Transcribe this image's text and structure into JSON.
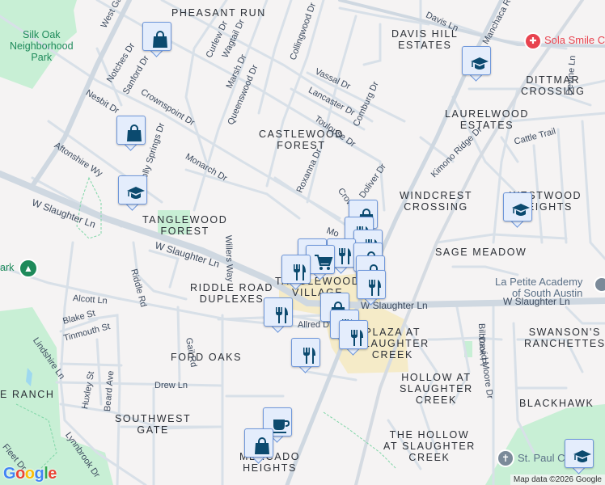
{
  "neighborhoods": {
    "pheasant_run": "PHEASANT RUN",
    "davis_hill": [
      "DAVIS HILL",
      "ESTATES"
    ],
    "dittmar": [
      "DITTMAR",
      "CROSSING"
    ],
    "laurelwood": [
      "LAURELWOOD",
      "ESTATES"
    ],
    "castlewood": [
      "CASTLEWOOD",
      "FOREST"
    ],
    "windcrest": [
      "WINDCREST",
      "CROSSING"
    ],
    "westwood": [
      "WESTWOOD",
      "HEIGHTS"
    ],
    "tanglewood_forest": [
      "TANGLEWOOD",
      "FOREST"
    ],
    "sage_meadow": "SAGE MEADOW",
    "tanglewood_village": [
      "TANGLEWOOD",
      "VILLAGE"
    ],
    "riddle_road": [
      "RIDDLE ROAD",
      "DUPLEXES"
    ],
    "plaza": [
      "PLAZA AT",
      "SLAUGHTER",
      "CREEK"
    ],
    "swansons": [
      "SWANSON'S",
      "RANCHETTES"
    ],
    "ford_oaks": "FORD OAKS",
    "hollow": [
      "HOLLOW AT",
      "SLAUGHTER",
      "CREEK"
    ],
    "blackhawk": "BLACKHAWK",
    "ranch": "E RANCH",
    "southwest_gate": [
      "SOUTHWEST",
      "GATE"
    ],
    "the_hollow": [
      "THE HOLLOW",
      "AT SLAUGHTER",
      "CREEK"
    ],
    "mercado": [
      "MERCADO",
      "HEIGHTS"
    ]
  },
  "parks": {
    "silk_oak": [
      "Silk Oak",
      "Neighborhood",
      "Park"
    ],
    "park_fragment": "ark"
  },
  "pois": {
    "sola_smile": "Sola Smile C",
    "la_petite": [
      "La Petite Academy",
      "of South Austin"
    ],
    "st_paul": "St. Paul C"
  },
  "streets": {
    "west_gate": "West Ga",
    "notches": "Notches Dr",
    "sanford": "Sanford Dr",
    "nesbit": "Nesbit Dr",
    "crownspoint": "Crownspoint Dr",
    "curlew": "Curlew Dr",
    "wagtail": "Wagtail Dr",
    "marsh": "Marsh Dr",
    "queenswood": "Queenswood Dr",
    "collingwood": "Collingwood Dr",
    "vassal": "Vassal Dr",
    "lancaster": "Lancaster Dr",
    "toulouse": "Toulouse Dr",
    "comburg": "Comburg Dr",
    "davis": "Davis Ln",
    "manchaca": "Manchaca Rd",
    "devine": "Devine Ln",
    "cattle": "Cattle Trail",
    "kimono": "Kimono Ridge Dr",
    "doliver": "Doliver Dr",
    "crownspoint2": "Crownspoint Dr",
    "roxanna": "Roxanna Dr",
    "monarch": "Monarch Dr",
    "holly_springs": "Holly Springs Dr",
    "aftonshire": "Aftonshire Wy",
    "willers": "Willers Way",
    "w_slaughter_1": "W Slaughter Ln",
    "w_slaughter_2": "W Slaughter Ln",
    "w_slaughter_3": "W Slaughter Ln",
    "w_slaughter_4": "W Slaughter Ln",
    "riddle": "Riddle Rd",
    "alcott": "Alcott Ln",
    "blake": "Blake St",
    "tinmouth": "Tinmouth St",
    "lindshire": "Lindshire Ln",
    "huxley": "Huxley St",
    "beard": "Beard Ave",
    "gail": "Gail Rd",
    "drew": "Drew Ln",
    "allred": "Allred Dr",
    "lynnbrook": "Lynnbrook Dr",
    "fleet": "Fleet Dr",
    "bilbrook": "Bilbrook Pl",
    "david_moore": "David Moore Dr",
    "mo": "Mo"
  },
  "markers": [
    {
      "type": "shopping"
    },
    {
      "type": "shopping"
    },
    {
      "type": "school"
    },
    {
      "type": "school"
    },
    {
      "type": "school"
    },
    {
      "type": "school"
    },
    {
      "type": "shopping"
    },
    {
      "type": "restaurant"
    },
    {
      "type": "restaurant"
    },
    {
      "type": "restaurant"
    },
    {
      "type": "cart"
    },
    {
      "type": "cart"
    },
    {
      "type": "restaurant"
    },
    {
      "type": "shopping"
    },
    {
      "type": "shopping"
    },
    {
      "type": "restaurant"
    },
    {
      "type": "restaurant"
    },
    {
      "type": "shopping"
    },
    {
      "type": "restaurant"
    },
    {
      "type": "restaurant"
    },
    {
      "type": "restaurant"
    },
    {
      "type": "coffee"
    },
    {
      "type": "shopping"
    }
  ],
  "colors": {
    "marker_icon": "#0b4a6f",
    "marker_bg": "#e4edfc",
    "marker_border": "#6f97da",
    "park": "#c8efd5",
    "commercial": "#f5ebc8",
    "road": "#d3dce6",
    "dental": "#e8434f"
  },
  "attribution": {
    "map_data": "Map data ©2026 Google",
    "logo": "Google"
  }
}
